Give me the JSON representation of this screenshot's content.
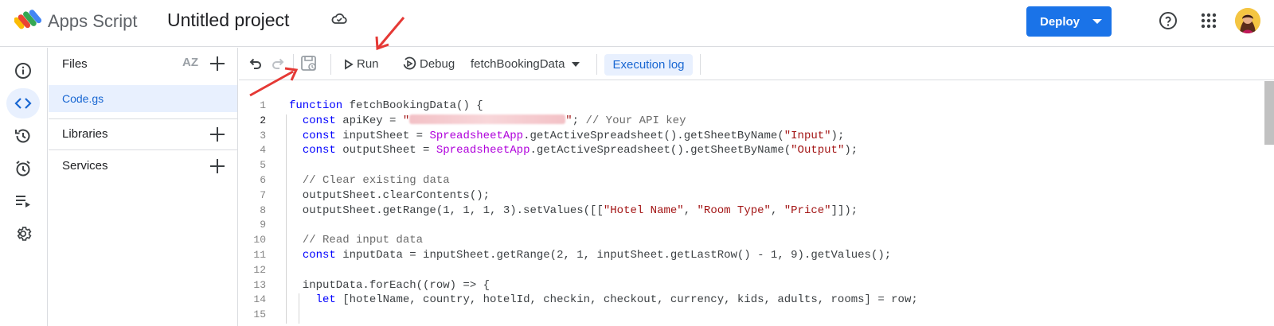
{
  "header": {
    "app_name": "Apps Script",
    "project_title": "Untitled project",
    "deploy_label": "Deploy"
  },
  "rail": {
    "items": [
      "overview-icon",
      "editor-icon",
      "history-icon",
      "triggers-icon",
      "executions-icon",
      "settings-icon"
    ],
    "active": "editor-icon"
  },
  "files_panel": {
    "title": "Files",
    "sort_label": "AZ",
    "files": [
      "Code.gs"
    ],
    "libraries_label": "Libraries",
    "services_label": "Services"
  },
  "toolbar": {
    "run_label": "Run",
    "debug_label": "Debug",
    "function_select": "fetchBookingData",
    "execution_log_label": "Execution log"
  },
  "editor": {
    "current_line": 2,
    "line_numbers": [
      "1",
      "2",
      "3",
      "4",
      "5",
      "6",
      "7",
      "8",
      "9",
      "10",
      "11",
      "12",
      "13",
      "14",
      "15"
    ],
    "lines": [
      [
        {
          "t": "kw",
          "v": "function"
        },
        {
          "t": "p",
          "v": " fetchBookingData() {"
        }
      ],
      [
        {
          "t": "p",
          "v": "  "
        },
        {
          "t": "kw",
          "v": "const"
        },
        {
          "t": "p",
          "v": " apiKey = "
        },
        {
          "t": "str",
          "v": "\""
        },
        {
          "t": "redacted",
          "v": ""
        },
        {
          "t": "str",
          "v": "\""
        },
        {
          "t": "p",
          "v": "; "
        },
        {
          "t": "cm",
          "v": "// Your API key"
        }
      ],
      [
        {
          "t": "p",
          "v": "  "
        },
        {
          "t": "kw",
          "v": "const"
        },
        {
          "t": "p",
          "v": " inputSheet = "
        },
        {
          "t": "cls",
          "v": "SpreadsheetApp"
        },
        {
          "t": "p",
          "v": ".getActiveSpreadsheet().getSheetByName("
        },
        {
          "t": "str",
          "v": "\"Input\""
        },
        {
          "t": "p",
          "v": ");"
        }
      ],
      [
        {
          "t": "p",
          "v": "  "
        },
        {
          "t": "kw",
          "v": "const"
        },
        {
          "t": "p",
          "v": " outputSheet = "
        },
        {
          "t": "cls",
          "v": "SpreadsheetApp"
        },
        {
          "t": "p",
          "v": ".getActiveSpreadsheet().getSheetByName("
        },
        {
          "t": "str",
          "v": "\"Output\""
        },
        {
          "t": "p",
          "v": ");"
        }
      ],
      [],
      [
        {
          "t": "p",
          "v": "  "
        },
        {
          "t": "cm",
          "v": "// Clear existing data"
        }
      ],
      [
        {
          "t": "p",
          "v": "  outputSheet.clearContents();"
        }
      ],
      [
        {
          "t": "p",
          "v": "  outputSheet.getRange(1, 1, 1, 3).setValues([["
        },
        {
          "t": "str",
          "v": "\"Hotel Name\""
        },
        {
          "t": "p",
          "v": ", "
        },
        {
          "t": "str",
          "v": "\"Room Type\""
        },
        {
          "t": "p",
          "v": ", "
        },
        {
          "t": "str",
          "v": "\"Price\""
        },
        {
          "t": "p",
          "v": "]]);"
        }
      ],
      [],
      [
        {
          "t": "p",
          "v": "  "
        },
        {
          "t": "cm",
          "v": "// Read input data"
        }
      ],
      [
        {
          "t": "p",
          "v": "  "
        },
        {
          "t": "kw",
          "v": "const"
        },
        {
          "t": "p",
          "v": " inputData = inputSheet.getRange(2, 1, inputSheet.getLastRow() - 1, 9).getValues();"
        }
      ],
      [],
      [
        {
          "t": "p",
          "v": "  inputData.forEach((row) => {"
        }
      ],
      [
        {
          "t": "p",
          "v": "    "
        },
        {
          "t": "kw",
          "v": "let"
        },
        {
          "t": "p",
          "v": " [hotelName, country, hotelId, checkin, checkout, currency, kids, adults, rooms] = row;"
        }
      ],
      []
    ]
  },
  "colors": {
    "accent": "#1a73e8",
    "selected_bg": "#e8f0fe",
    "annotation_arrow": "#e53935"
  }
}
